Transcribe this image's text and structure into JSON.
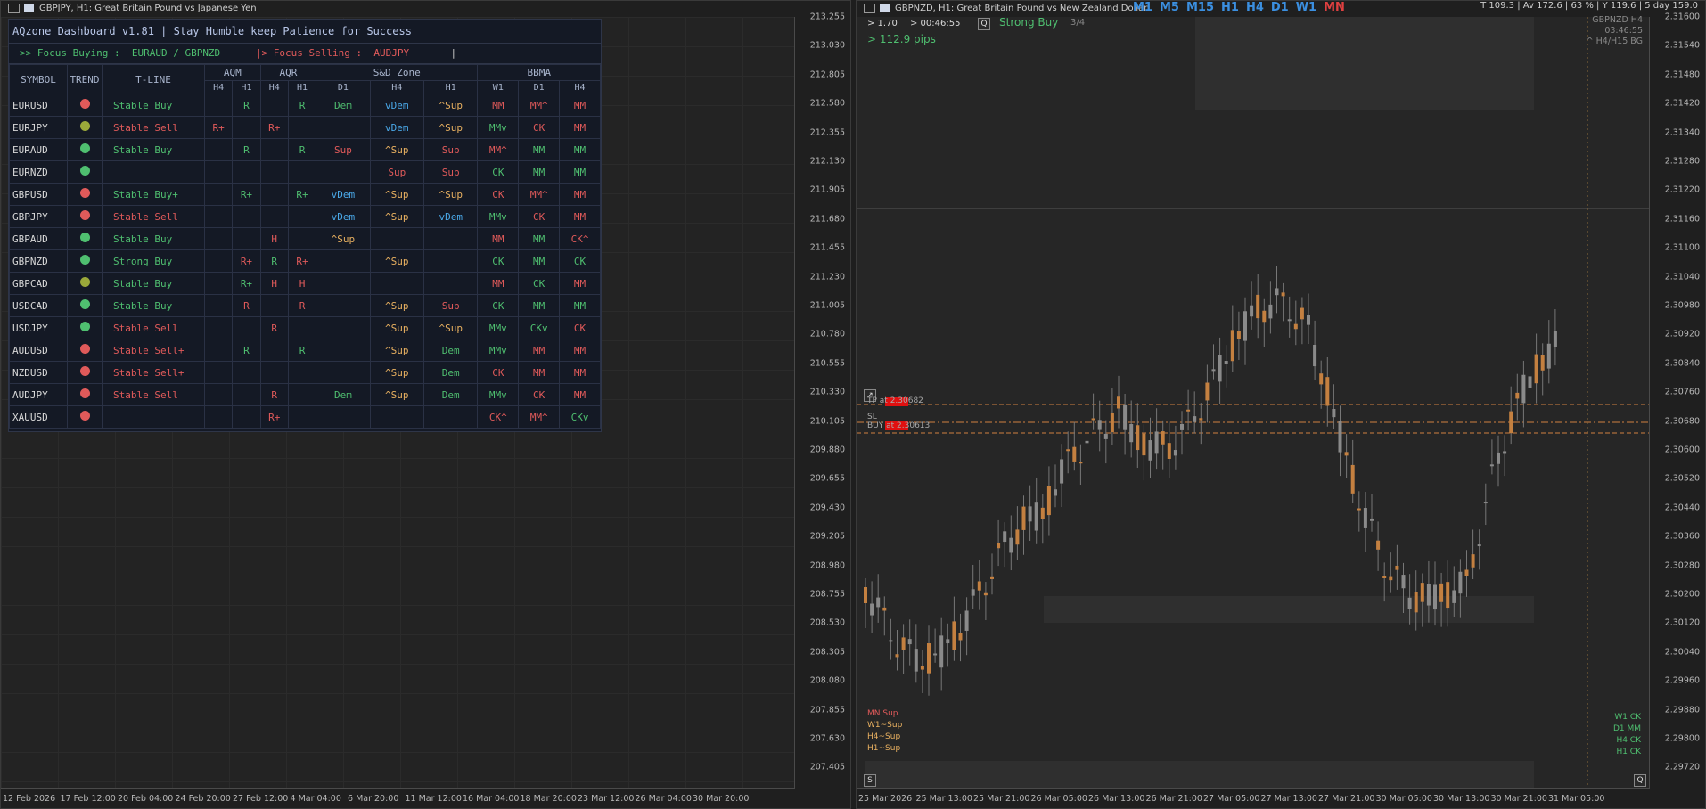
{
  "left_window": {
    "title": "GBPJPY, H1:  Great Britain Pound vs Japanese Yen",
    "price_ticks": [
      "213.255",
      "213.030",
      "212.805",
      "212.580",
      "212.355",
      "212.130",
      "211.905",
      "211.680",
      "211.455",
      "211.230",
      "211.005",
      "210.780",
      "210.555",
      "210.330",
      "210.105",
      "209.880",
      "209.655",
      "209.430",
      "209.205",
      "208.980",
      "208.755",
      "208.530",
      "208.305",
      "208.080",
      "207.855",
      "207.630",
      "207.405"
    ],
    "time_ticks": [
      "12 Feb 2026",
      "17 Feb 12:00",
      "20 Feb 04:00",
      "24 Feb 20:00",
      "27 Feb 12:00",
      "4 Mar 04:00",
      "6 Mar 20:00",
      "11 Mar 12:00",
      "16 Mar 04:00",
      "18 Mar 20:00",
      "23 Mar 12:00",
      "26 Mar 04:00",
      "30 Mar 20:00"
    ],
    "current_price_label": "210.555"
  },
  "dashboard": {
    "title": "AQzone Dashboard  v1.81 | Stay Humble keep Patience for Success",
    "focus_buying_label": ">>  Focus Buying :",
    "focus_buying_value": "EURAUD / GBPNZD",
    "focus_selling_label": "|>  Focus Selling :",
    "focus_selling_value": "AUDJPY",
    "focus_sep": "|",
    "headers": {
      "symbol": "SYMBOL",
      "trend": "TREND",
      "tline": "T-LINE",
      "aqm": "AQM",
      "aqr": "AQR",
      "sd": "S&D Zone",
      "bbma": "BBMA"
    },
    "subheaders": [
      "H4",
      "H1",
      "H4",
      "H1",
      "D1",
      "H4",
      "H1",
      "W1",
      "D1",
      "H4"
    ],
    "rows": [
      {
        "symbol": "EURUSD",
        "trend": "#e05a5a",
        "tline": "Stable Buy",
        "tc": "g",
        "cells": [
          [
            "",
            ""
          ],
          [
            "R",
            "g"
          ],
          [
            "",
            ""
          ],
          [
            "R",
            "g"
          ],
          [
            "Dem",
            "g"
          ],
          [
            "vDem",
            "b"
          ],
          [
            "^Sup",
            "o"
          ],
          [
            "MM",
            "r"
          ],
          [
            "MM^",
            "r"
          ],
          [
            "MM",
            "r"
          ]
        ]
      },
      {
        "symbol": "EURJPY",
        "trend": "#9aa83a",
        "tline": "Stable Sell",
        "tc": "r",
        "cells": [
          [
            "R+",
            "r"
          ],
          [
            "",
            ""
          ],
          [
            "R+",
            "r"
          ],
          [
            "",
            ""
          ],
          [
            "",
            ""
          ],
          [
            "vDem",
            "b"
          ],
          [
            "^Sup",
            "o"
          ],
          [
            "MMv",
            "g"
          ],
          [
            "CK",
            "r"
          ],
          [
            "MM",
            "r"
          ]
        ]
      },
      {
        "symbol": "EURAUD",
        "trend": "#4fbf70",
        "tline": "Stable Buy",
        "tc": "g",
        "cells": [
          [
            "",
            ""
          ],
          [
            "R",
            "g"
          ],
          [
            "",
            ""
          ],
          [
            "R",
            "g"
          ],
          [
            "Sup",
            "r"
          ],
          [
            "^Sup",
            "o"
          ],
          [
            "Sup",
            "r"
          ],
          [
            "MM^",
            "r"
          ],
          [
            "MM",
            "g"
          ],
          [
            "MM",
            "g"
          ]
        ]
      },
      {
        "symbol": "EURNZD",
        "trend": "#4fbf70",
        "tline": "",
        "tc": "g",
        "cells": [
          [
            "",
            ""
          ],
          [
            "",
            ""
          ],
          [
            "",
            ""
          ],
          [
            "",
            ""
          ],
          [
            "",
            ""
          ],
          [
            "Sup",
            "r"
          ],
          [
            "Sup",
            "r"
          ],
          [
            "CK",
            "g"
          ],
          [
            "MM",
            "g"
          ],
          [
            "MM",
            "g"
          ]
        ]
      },
      {
        "symbol": "GBPUSD",
        "trend": "#e05a5a",
        "tline": "Stable Buy+",
        "tc": "g",
        "cells": [
          [
            "",
            ""
          ],
          [
            "R+",
            "g"
          ],
          [
            "",
            ""
          ],
          [
            "R+",
            "g"
          ],
          [
            "vDem",
            "b"
          ],
          [
            "^Sup",
            "o"
          ],
          [
            "^Sup",
            "o"
          ],
          [
            "CK",
            "r"
          ],
          [
            "MM^",
            "r"
          ],
          [
            "MM",
            "r"
          ]
        ]
      },
      {
        "symbol": "GBPJPY",
        "trend": "#e05a5a",
        "tline": "Stable Sell",
        "tc": "r",
        "cells": [
          [
            "",
            ""
          ],
          [
            "",
            ""
          ],
          [
            "",
            ""
          ],
          [
            "",
            ""
          ],
          [
            "vDem",
            "b"
          ],
          [
            "^Sup",
            "o"
          ],
          [
            "vDem",
            "b"
          ],
          [
            "MMv",
            "g"
          ],
          [
            "CK",
            "r"
          ],
          [
            "MM",
            "r"
          ]
        ]
      },
      {
        "symbol": "GBPAUD",
        "trend": "#4fbf70",
        "tline": "Stable Buy",
        "tc": "g",
        "cells": [
          [
            "",
            ""
          ],
          [
            "",
            ""
          ],
          [
            "H",
            "r"
          ],
          [
            "",
            ""
          ],
          [
            "^Sup",
            "o"
          ],
          [
            "",
            ""
          ],
          [
            "",
            ""
          ],
          [
            "MM",
            "r"
          ],
          [
            "MM",
            "g"
          ],
          [
            "CK^",
            "r"
          ]
        ]
      },
      {
        "symbol": "GBPNZD",
        "trend": "#4fbf70",
        "tline": "Strong Buy",
        "tc": "g",
        "cells": [
          [
            "",
            ""
          ],
          [
            "R+",
            "r"
          ],
          [
            "R",
            "g"
          ],
          [
            "R+",
            "r"
          ],
          [
            "",
            ""
          ],
          [
            "^Sup",
            "o"
          ],
          [
            "",
            ""
          ],
          [
            "CK",
            "g"
          ],
          [
            "MM",
            "g"
          ],
          [
            "CK",
            "g"
          ]
        ]
      },
      {
        "symbol": "GBPCAD",
        "trend": "#9aa83a",
        "tline": "Stable Buy",
        "tc": "g",
        "cells": [
          [
            "",
            ""
          ],
          [
            "R+",
            "g"
          ],
          [
            "H",
            "r"
          ],
          [
            "H",
            "r"
          ],
          [
            "",
            ""
          ],
          [
            "",
            ""
          ],
          [
            "",
            ""
          ],
          [
            "MM",
            "r"
          ],
          [
            "CK",
            "g"
          ],
          [
            "MM",
            "r"
          ]
        ]
      },
      {
        "symbol": "USDCAD",
        "trend": "#4fbf70",
        "tline": "Stable Buy",
        "tc": "g",
        "cells": [
          [
            "",
            ""
          ],
          [
            "R",
            "r"
          ],
          [
            "",
            ""
          ],
          [
            "R",
            "r"
          ],
          [
            "",
            ""
          ],
          [
            "^Sup",
            "o"
          ],
          [
            "Sup",
            "r"
          ],
          [
            "CK",
            "g"
          ],
          [
            "MM",
            "g"
          ],
          [
            "MM",
            "g"
          ]
        ]
      },
      {
        "symbol": "USDJPY",
        "trend": "#4fbf70",
        "tline": "Stable Sell",
        "tc": "r",
        "cells": [
          [
            "",
            ""
          ],
          [
            "",
            ""
          ],
          [
            "R",
            "r"
          ],
          [
            "",
            ""
          ],
          [
            "",
            ""
          ],
          [
            "^Sup",
            "o"
          ],
          [
            "^Sup",
            "o"
          ],
          [
            "MMv",
            "g"
          ],
          [
            "CKv",
            "g"
          ],
          [
            "CK",
            "r"
          ]
        ]
      },
      {
        "symbol": "AUDUSD",
        "trend": "#e05a5a",
        "tline": "Stable Sell+",
        "tc": "r",
        "cells": [
          [
            "",
            ""
          ],
          [
            "R",
            "g"
          ],
          [
            "",
            ""
          ],
          [
            "R",
            "g"
          ],
          [
            "",
            ""
          ],
          [
            "^Sup",
            "o"
          ],
          [
            "Dem",
            "g"
          ],
          [
            "MMv",
            "g"
          ],
          [
            "MM",
            "r"
          ],
          [
            "MM",
            "r"
          ]
        ]
      },
      {
        "symbol": "NZDUSD",
        "trend": "#e05a5a",
        "tline": "Stable Sell+",
        "tc": "r",
        "cells": [
          [
            "",
            ""
          ],
          [
            "",
            ""
          ],
          [
            "",
            ""
          ],
          [
            "",
            ""
          ],
          [
            "",
            ""
          ],
          [
            "^Sup",
            "o"
          ],
          [
            "Dem",
            "g"
          ],
          [
            "CK",
            "r"
          ],
          [
            "MM",
            "r"
          ],
          [
            "MM",
            "r"
          ]
        ]
      },
      {
        "symbol": "AUDJPY",
        "trend": "#e05a5a",
        "tline": "Stable Sell",
        "tc": "r",
        "cells": [
          [
            "",
            ""
          ],
          [
            "",
            ""
          ],
          [
            "R",
            "r"
          ],
          [
            "",
            ""
          ],
          [
            "Dem",
            "g"
          ],
          [
            "^Sup",
            "o"
          ],
          [
            "Dem",
            "g"
          ],
          [
            "MMv",
            "g"
          ],
          [
            "CK",
            "r"
          ],
          [
            "MM",
            "r"
          ]
        ]
      },
      {
        "symbol": "XAUUSD",
        "trend": "#e05a5a",
        "tline": "",
        "tc": "g",
        "cells": [
          [
            "",
            ""
          ],
          [
            "",
            ""
          ],
          [
            "R+",
            "r"
          ],
          [
            "",
            ""
          ],
          [
            "",
            ""
          ],
          [
            "",
            ""
          ],
          [
            "",
            ""
          ],
          [
            "CK^",
            "r"
          ],
          [
            "MM^",
            "r"
          ],
          [
            "CKv",
            "g"
          ]
        ]
      }
    ]
  },
  "right_window": {
    "title": "GBPNZD, H1:  Great Britain Pound vs New Zealand Dollar",
    "timeframes": [
      "M1",
      "M5",
      "M15",
      "H1",
      "H4",
      "D1",
      "W1",
      "MN"
    ],
    "stats": "T 109.3 | Av 172.6 | 63 % | Y 119.6 | 5 day 159.0",
    "spread": "> 1.70",
    "timer": "> 00:46:55",
    "signal": "Strong Buy",
    "signal_count": "3/4",
    "pips": "> 112.9 pips",
    "corner_info": [
      "GBPNZD H4",
      "03:46:55",
      "^ H4/H15 BG"
    ],
    "tp_label": "TP          at 2.30682",
    "sl_label": "SL",
    "buy_label": "BUY          at 2.30613",
    "bottom_left_notes": [
      "MN Sup",
      "W1~Sup",
      "H4~Sup",
      "H1~Sup"
    ],
    "bottom_right_notes": [
      "W1 CK",
      "D1 MM",
      "H4 CK",
      "H1 CK"
    ],
    "price_ticks": [
      "2.31600",
      "2.31540",
      "2.31480",
      "2.31420",
      "2.31340",
      "2.31280",
      "2.31220",
      "2.31160",
      "2.31100",
      "2.31040",
      "2.30980",
      "2.30920",
      "2.30840",
      "2.30760",
      "2.30680",
      "2.30600",
      "2.30520",
      "2.30440",
      "2.30360",
      "2.30280",
      "2.30200",
      "2.30120",
      "2.30040",
      "2.29960",
      "2.29880",
      "2.29800",
      "2.29720"
    ],
    "time_ticks": [
      "25 Mar 2026",
      "25 Mar 13:00",
      "25 Mar 21:00",
      "26 Mar 05:00",
      "26 Mar 13:00",
      "26 Mar 21:00",
      "27 Mar 05:00",
      "27 Mar 13:00",
      "27 Mar 21:00",
      "30 Mar 05:00",
      "30 Mar 13:00",
      "30 Mar 21:00",
      "31 Mar 05:00"
    ]
  }
}
